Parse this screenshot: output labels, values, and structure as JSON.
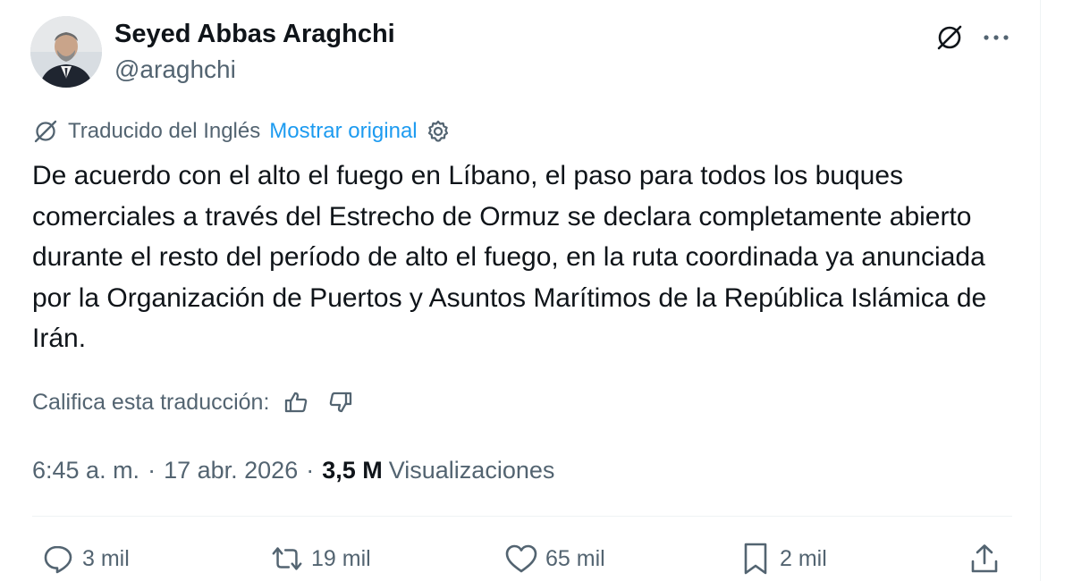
{
  "author": {
    "display_name": "Seyed Abbas Araghchi",
    "handle": "@araghchi",
    "avatar_icon": "profile-photo"
  },
  "header_actions": {
    "translate_icon": "translate-icon",
    "more_icon": "more-icon"
  },
  "translation": {
    "label": "Traducido del Inglés",
    "show_original": "Mostrar original",
    "settings_icon": "gear-icon"
  },
  "tweet": {
    "text": "De acuerdo con el alto el fuego en Líbano, el paso para todos los buques comerciales a través del Estrecho de Ormuz se declara completamente abierto durante el resto del período de alto el fuego, en la ruta coordinada ya anunciada por la Organización de Puertos y Asuntos Marítimos de la República Islámica de Irán."
  },
  "rating": {
    "label": "Califica esta traducción:",
    "up_icon": "thumbs-up-icon",
    "down_icon": "thumbs-down-icon"
  },
  "meta": {
    "time": "6:45 a. m.",
    "separator": "·",
    "date": "17 abr. 2026",
    "separator2": "·",
    "views_count": "3,5 M",
    "views_label": "Visualizaciones"
  },
  "actions": {
    "replies": "3 mil",
    "retweets": "19 mil",
    "likes": "65 mil",
    "bookmarks": "2 mil"
  },
  "colors": {
    "text": "#0f1419",
    "secondary": "#536471",
    "link": "#1d9bf0",
    "divider": "#eff3f4"
  }
}
